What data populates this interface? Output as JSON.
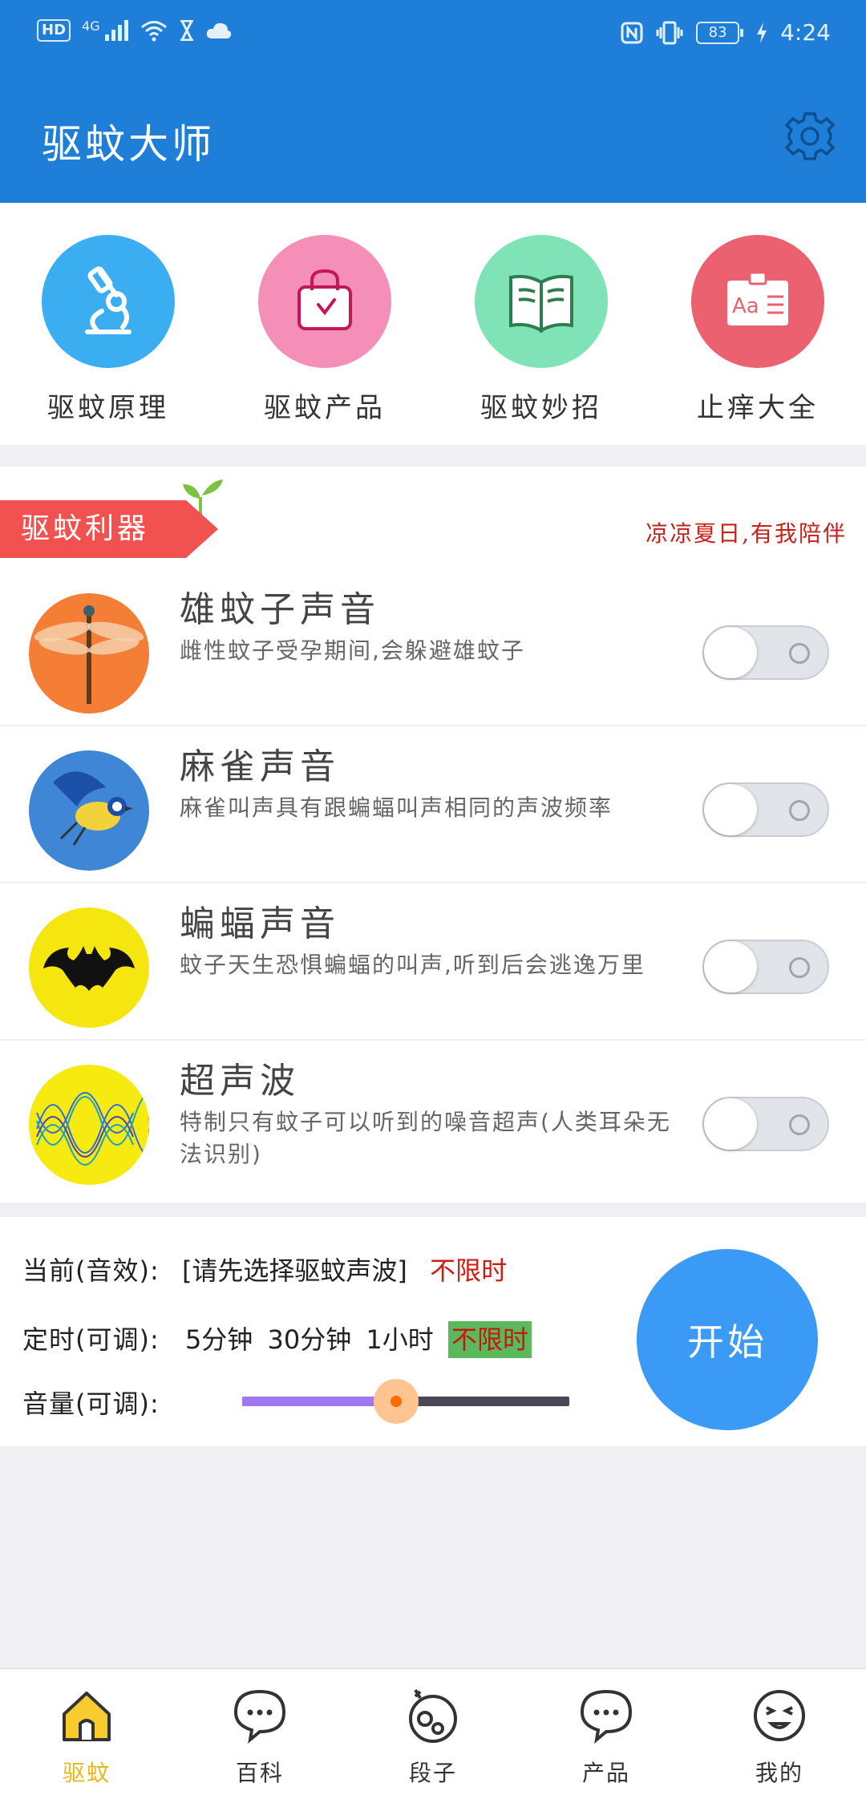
{
  "status_bar": {
    "hd": "HD",
    "network": "4G",
    "battery": "83",
    "time": "4:24"
  },
  "header": {
    "title": "驱蚊大师",
    "settings_icon": "gear-icon"
  },
  "quick_categories": [
    {
      "label": "驱蚊原理",
      "icon": "microscope-icon",
      "color": "#3aaef0"
    },
    {
      "label": "驱蚊产品",
      "icon": "shopping-bag-icon",
      "color": "#f58fb7"
    },
    {
      "label": "驱蚊妙招",
      "icon": "book-icon",
      "color": "#7fe3b7"
    },
    {
      "label": "止痒大全",
      "icon": "id-card-icon",
      "color": "#eb6170"
    }
  ],
  "tools": {
    "badge": "驱蚊利器",
    "slogan": "凉凉夏日,有我陪伴",
    "items": [
      {
        "title": "雄蚊子声音",
        "desc": "雌性蚊子受孕期间,会躲避雄蚊子",
        "icon": "dragonfly-icon",
        "enabled": false
      },
      {
        "title": "麻雀声音",
        "desc": "麻雀叫声具有跟蝙蝠叫声相同的声波频率",
        "icon": "bird-icon",
        "enabled": false
      },
      {
        "title": "蝙蝠声音",
        "desc": "蚊子天生恐惧蝙蝠的叫声,听到后会逃逸万里",
        "icon": "bat-icon",
        "enabled": false
      },
      {
        "title": "超声波",
        "desc": "特制只有蚊子可以听到的噪音超声(人类耳朵无法识别)",
        "icon": "wave-icon",
        "enabled": false
      }
    ]
  },
  "controls": {
    "current_label": "当前(音效):",
    "current_value": "[请先选择驱蚊声波]",
    "current_duration": "不限时",
    "timer_label": "定时(可调):",
    "timer_options": [
      "5分钟",
      "30分钟",
      "1小时",
      "不限时"
    ],
    "timer_selected": "不限时",
    "volume_label": "音量(可调):",
    "volume_level": 0.47,
    "start_label": "开始"
  },
  "bottom_nav": [
    {
      "label": "驱蚊",
      "icon": "home-icon",
      "active": true
    },
    {
      "label": "百科",
      "icon": "chat-bubble-icon",
      "active": false
    },
    {
      "label": "段子",
      "icon": "joke-icon",
      "active": false
    },
    {
      "label": "产品",
      "icon": "chat-bubble-icon",
      "active": false
    },
    {
      "label": "我的",
      "icon": "smiley-icon",
      "active": false
    }
  ]
}
